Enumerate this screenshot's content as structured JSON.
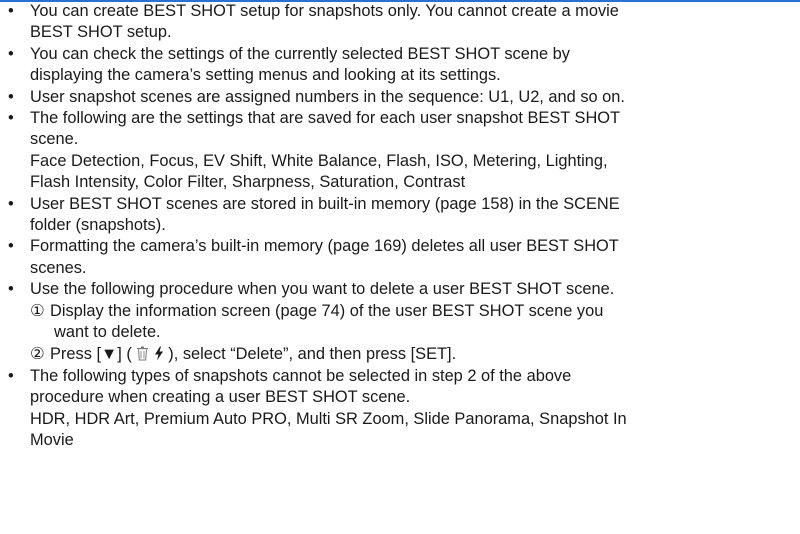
{
  "header_bar_color": "#2b6fcf",
  "bullets": [
    {
      "lines": [
        "You can create BEST SHOT setup for snapshots only. You cannot create a movie",
        "BEST SHOT setup."
      ]
    },
    {
      "lines": [
        "You can check the settings of the currently selected BEST SHOT scene by",
        "displaying the camera’s setting menus and looking at its settings."
      ]
    },
    {
      "lines": [
        "User snapshot scenes are assigned numbers in the sequence: U1, U2, and so on."
      ]
    },
    {
      "lines": [
        "The following are the settings that are saved for each user snapshot BEST SHOT",
        "scene.",
        "Face Detection, Focus, EV Shift, White Balance, Flash, ISO, Metering, Lighting,",
        "Flash Intensity, Color Filter, Sharpness, Saturation, Contrast"
      ]
    },
    {
      "lines": [
        "User BEST SHOT scenes are stored in built-in memory (page 158) in the SCENE",
        "folder (snapshots)."
      ]
    },
    {
      "lines": [
        "Formatting the camera’s built-in memory (page 169) deletes all user BEST SHOT",
        "scenes."
      ]
    },
    {
      "lines": [
        "Use the following procedure when you want to delete a user BEST SHOT scene."
      ],
      "steps": {
        "step1_num": "①",
        "step1_line1": "Display the information screen (page 74) of the user BEST SHOT scene you",
        "step1_line2": "want to delete.",
        "step2_num": "②",
        "step2_part1": "Press [▼] (",
        "step2_part2": "), select “Delete”, and then press [SET]."
      }
    },
    {
      "lines": [
        "The following types of snapshots cannot be selected in step 2 of the above",
        "procedure when creating a user BEST SHOT scene.",
        "HDR, HDR Art, Premium Auto PRO, Multi SR Zoom, Slide Panorama, Snapshot In",
        "Movie"
      ]
    }
  ]
}
